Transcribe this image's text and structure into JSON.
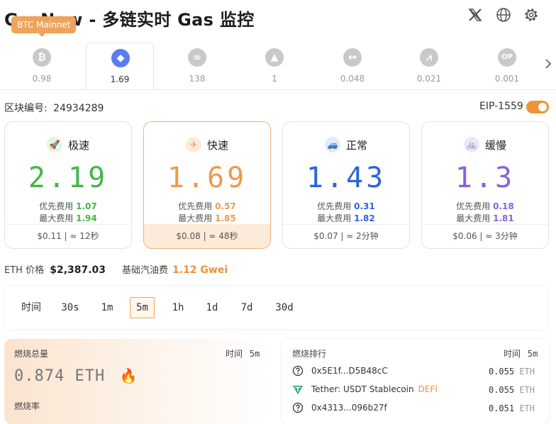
{
  "header": {
    "title": "GasNow - 多链实时 Gas 监控",
    "tooltip": "BTC Mainnet"
  },
  "chains": [
    {
      "name": "bitcoin-icon",
      "value": "0.98",
      "color": "#c9c9c9",
      "glyph": "₿"
    },
    {
      "name": "ethereum-icon",
      "value": "1.69",
      "color": "#5b7cf0",
      "glyph": "◆"
    },
    {
      "name": "polygon-icon",
      "value": "138",
      "color": "#c9c9c9",
      "glyph": "∞"
    },
    {
      "name": "avalanche-icon",
      "value": "1",
      "color": "#c9c9c9",
      "glyph": "▲"
    },
    {
      "name": "bridge-icon",
      "value": "0.048",
      "color": "#c9c9c9",
      "glyph": "↔"
    },
    {
      "name": "arbitrum-icon",
      "value": "0.021",
      "color": "#c9c9c9",
      "glyph": "⩘"
    },
    {
      "name": "optimism-icon",
      "value": "0.001",
      "color": "#c9c9c9",
      "glyph": "OP"
    }
  ],
  "block": {
    "label": "区块编号:",
    "number": "24934289",
    "eip_label": "EIP-1559"
  },
  "cards": [
    {
      "title": "极速",
      "value": "2.19",
      "color": "#43b649",
      "badge_bg": "#e3f5e4",
      "badge_glyph": "🚀",
      "priority_label": "优先费用",
      "priority": "1.07",
      "max_label": "最大费用",
      "max": "1.94",
      "footer": "$0.11 | ≈ 12秒"
    },
    {
      "title": "快速",
      "value": "1.69",
      "color": "#ec9b4f",
      "badge_bg": "#fdebd9",
      "badge_glyph": "✈",
      "priority_label": "优先费用",
      "priority": "0.57",
      "max_label": "最大费用",
      "max": "1.85",
      "footer": "$0.08 | ≈ 48秒"
    },
    {
      "title": "正常",
      "value": "1.43",
      "color": "#2d63de",
      "badge_bg": "#e2eafb",
      "badge_glyph": "🚙",
      "priority_label": "优先费用",
      "priority": "0.31",
      "max_label": "最大费用",
      "max": "1.82",
      "footer": "$0.07 | ≈ 2分钟"
    },
    {
      "title": "缓慢",
      "value": "1.3",
      "color": "#8b5fdc",
      "badge_bg": "#efe6fb",
      "badge_glyph": "🚲",
      "priority_label": "优先费用",
      "priority": "0.18",
      "max_label": "最大费用",
      "max": "1.81",
      "footer": "$0.06 | ≈ 3分钟"
    }
  ],
  "prices": {
    "eth_label": "ETH 价格",
    "eth_value": "$2,387.03",
    "base_label": "基础汽油费",
    "base_value": "1.12 Gwei"
  },
  "range": {
    "label": "时间",
    "options": [
      "30s",
      "1m",
      "5m",
      "1h",
      "1d",
      "7d",
      "30d"
    ],
    "active": "5m"
  },
  "burn": {
    "title": "燃烧总量",
    "time_label": "时间",
    "time_value": "5m",
    "value": "0.874 ETH",
    "rate_label": "燃烧率"
  },
  "ranking": {
    "title": "燃烧排行",
    "time_label": "时间",
    "time_value": "5m",
    "rows": [
      {
        "name": "0x5E1f...D5B48cC",
        "tag": "",
        "value": "0.055",
        "unit": "ETH",
        "icon": "question-circle-icon"
      },
      {
        "name": "Tether: USDT Stablecoin",
        "tag": "DEFI",
        "value": "0.055",
        "unit": "ETH",
        "icon": "tether-icon"
      },
      {
        "name": "0x4313...096b27f",
        "tag": "",
        "value": "0.051",
        "unit": "ETH",
        "icon": "question-circle-icon"
      }
    ]
  }
}
